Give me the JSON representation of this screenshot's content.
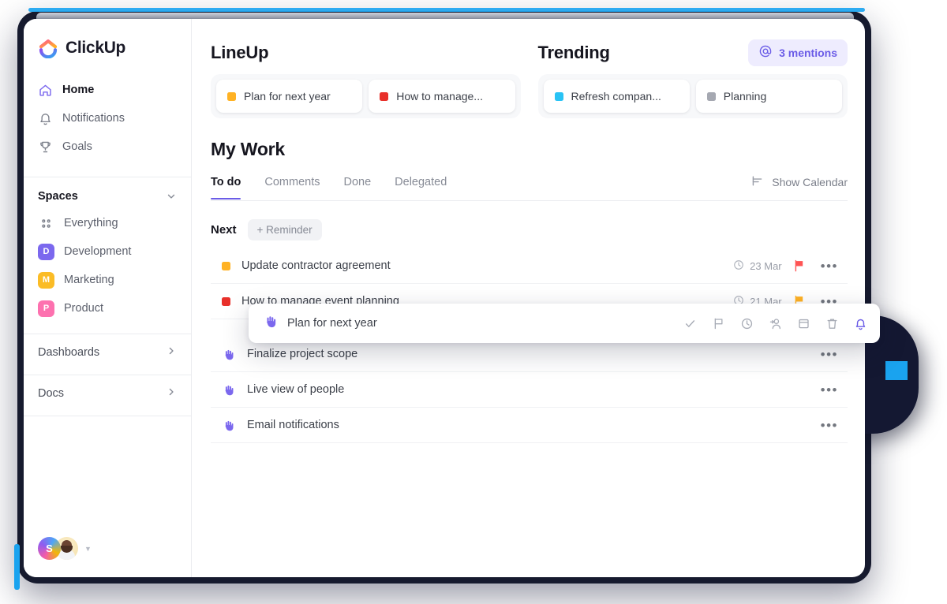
{
  "brand": {
    "name": "ClickUp",
    "logo_icon": "clickup-logo-icon"
  },
  "sidebar": {
    "nav": [
      {
        "label": "Home",
        "icon": "home-icon",
        "active": true
      },
      {
        "label": "Notifications",
        "icon": "bell-icon",
        "active": false
      },
      {
        "label": "Goals",
        "icon": "trophy-icon",
        "active": false
      }
    ],
    "spaces_section": {
      "title": "Spaces",
      "chevron_icon": "chevron-down-icon"
    },
    "spaces": [
      {
        "label": "Everything",
        "badge": "",
        "icon": "grid-dots-icon",
        "color": ""
      },
      {
        "label": "Development",
        "badge": "D",
        "color": "#7b68ee"
      },
      {
        "label": "Marketing",
        "badge": "M",
        "color": "#fbbc26"
      },
      {
        "label": "Product",
        "badge": "P",
        "color": "#fd71af"
      }
    ],
    "links": [
      {
        "label": "Dashboards",
        "icon": "chevron-right-icon"
      },
      {
        "label": "Docs",
        "icon": "chevron-right-icon"
      }
    ],
    "user": {
      "workspace_initial": "S",
      "avatar_icon": "user-avatar",
      "caret_icon": "caret-down-icon"
    }
  },
  "lineup": {
    "title": "LineUp",
    "cards": [
      {
        "label": "Plan for next year",
        "color": "#ffb224"
      },
      {
        "label": "How to manage...",
        "color": "#e8302a"
      }
    ]
  },
  "trending": {
    "title": "Trending",
    "cards": [
      {
        "label": "Refresh compan...",
        "color": "#29c3f5"
      },
      {
        "label": "Planning",
        "color": "#a5a8b1"
      }
    ]
  },
  "mentions": {
    "label": "3 mentions",
    "icon": "at-mention-icon",
    "color": "#6b5ce7"
  },
  "my_work": {
    "title": "My Work",
    "tabs": [
      {
        "label": "To do",
        "active": true
      },
      {
        "label": "Comments",
        "active": false
      },
      {
        "label": "Done",
        "active": false
      },
      {
        "label": "Delegated",
        "active": false
      }
    ],
    "show_calendar": {
      "label": "Show Calendar",
      "icon": "panel-toggle-icon"
    },
    "next_label": "Next",
    "reminder_button": "+ Reminder",
    "tasks_top": [
      {
        "name": "Update contractor agreement",
        "due": "23 Mar",
        "dot_color": "#ffb224",
        "flag_color": "#ff5454",
        "clock_icon": "clock-icon",
        "menu_icon": "kebab-menu-icon"
      },
      {
        "name": "How to manage event planning",
        "due": "21 Mar",
        "dot_color": "#e8302a",
        "flag_color": "#ffb224",
        "clock_icon": "clock-icon",
        "menu_icon": "kebab-menu-icon"
      }
    ],
    "tasks_bottom": [
      {
        "name": "Finalize project scope",
        "icon": "drag-hand-icon",
        "menu_icon": "kebab-menu-icon"
      },
      {
        "name": "Live view of people",
        "icon": "drag-hand-icon",
        "menu_icon": "kebab-menu-icon"
      },
      {
        "name": "Email notifications",
        "icon": "drag-hand-icon",
        "menu_icon": "kebab-menu-icon"
      }
    ]
  },
  "drag_popup": {
    "title": "Plan for next year",
    "icon": "drag-hand-icon",
    "actions": [
      {
        "name": "complete",
        "icon": "check-icon",
        "active": false
      },
      {
        "name": "priority",
        "icon": "flag-icon",
        "active": false
      },
      {
        "name": "due-date",
        "icon": "clock-icon",
        "active": false
      },
      {
        "name": "assign",
        "icon": "person-add-icon",
        "active": false
      },
      {
        "name": "schedule",
        "icon": "calendar-icon",
        "active": false
      },
      {
        "name": "delete",
        "icon": "trash-icon",
        "active": false
      },
      {
        "name": "remind",
        "icon": "bell-icon",
        "active": true
      }
    ]
  },
  "colors": {
    "accent": "#6b5ce7",
    "text": "#16161f",
    "muted": "#878b96"
  }
}
